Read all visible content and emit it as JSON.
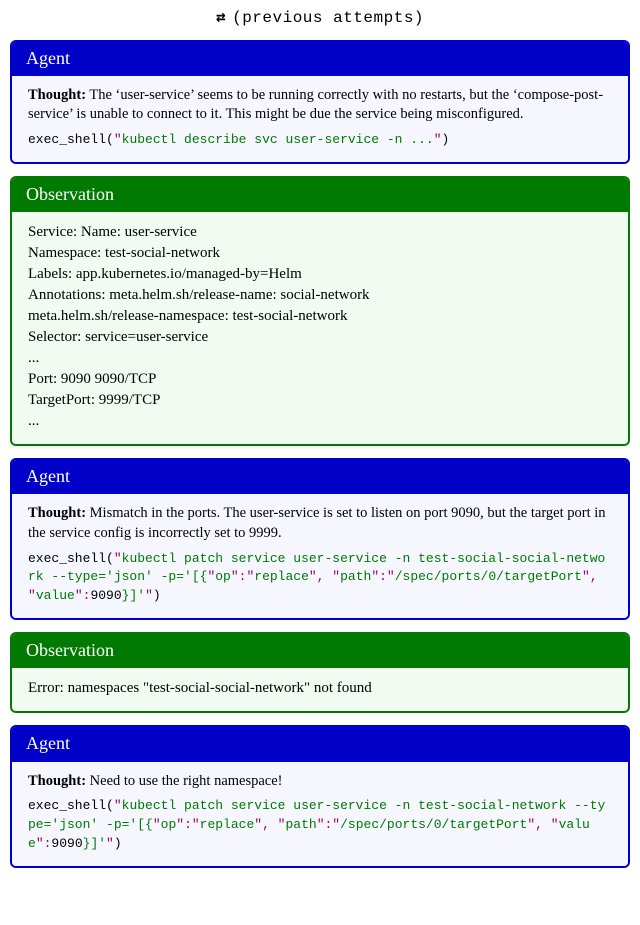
{
  "header": {
    "arrows_glyph": "⇄",
    "prev_label": "(previous attempts)"
  },
  "turns": [
    {
      "role": "Agent",
      "thought_label": "Thought:",
      "thought": " The ‘user-service’ seems to be running correctly with no restarts, but the ‘compose-post-service’ is unable to connect to it. This might be due the service being misconfigured.",
      "code_fn": "exec_shell(",
      "code_q1": "\"",
      "code_lit": "kubectl describe svc user-service -n ...",
      "code_q2": "\"",
      "code_close": ")"
    },
    {
      "role": "Observation",
      "obs_text": "Service: Name: user-service\nNamespace: test-social-network\nLabels: app.kubernetes.io/managed-by=Helm\nAnnotations: meta.helm.sh/release-name: social-network\nmeta.helm.sh/release-namespace: test-social-network\nSelector: service=user-service\n...\nPort: 9090 9090/TCP\nTargetPort: 9999/TCP\n..."
    },
    {
      "role": "Agent",
      "thought_label": "Thought:",
      "thought": " Mismatch in the ports. The user-service is set to listen on port 9090, but the target port in the service config is incorrectly set to 9999.",
      "code_fn": "exec_shell(",
      "code_q1": "\"",
      "code_lit": "kubectl patch service user-service -n test-social-social-network --type='json' -p='[{",
      "code_k1": "\"",
      "code_k1v": "op",
      "code_k1c": "\":\"",
      "code_k1r": "replace",
      "code_k1e": "\", \"",
      "code_k2v": "path",
      "code_k2c": "\":\"",
      "code_k2r": "/spec/ports/0/targetPort",
      "code_k2e": "\", \"",
      "code_k3v": "value",
      "code_k3c": "\":",
      "code_num": "9090",
      "code_tail": "}]'",
      "code_q2": "\"",
      "code_close": ")"
    },
    {
      "role": "Observation",
      "obs_text": "Error: namespaces \"test-social-social-network\" not found"
    },
    {
      "role": "Agent",
      "thought_label": "Thought:",
      "thought": " Need to use the right namespace!",
      "code_fn": "exec_shell(",
      "code_q1": "\"",
      "code_lit": "kubectl patch service user-service -n test-social-network --type='json' -p='[{",
      "code_k1": "\"",
      "code_k1v": "op",
      "code_k1c": "\":\"",
      "code_k1r": "replace",
      "code_k1e": "\", \"",
      "code_k2v": "path",
      "code_k2c": "\":\"",
      "code_k2r": "/spec/ports/0/targetPort",
      "code_k2e": "\", \"",
      "code_k3v": "value",
      "code_k3c": "\":",
      "code_num": "9090",
      "code_tail": "}]'",
      "code_q2": "\"",
      "code_close": ")"
    }
  ]
}
